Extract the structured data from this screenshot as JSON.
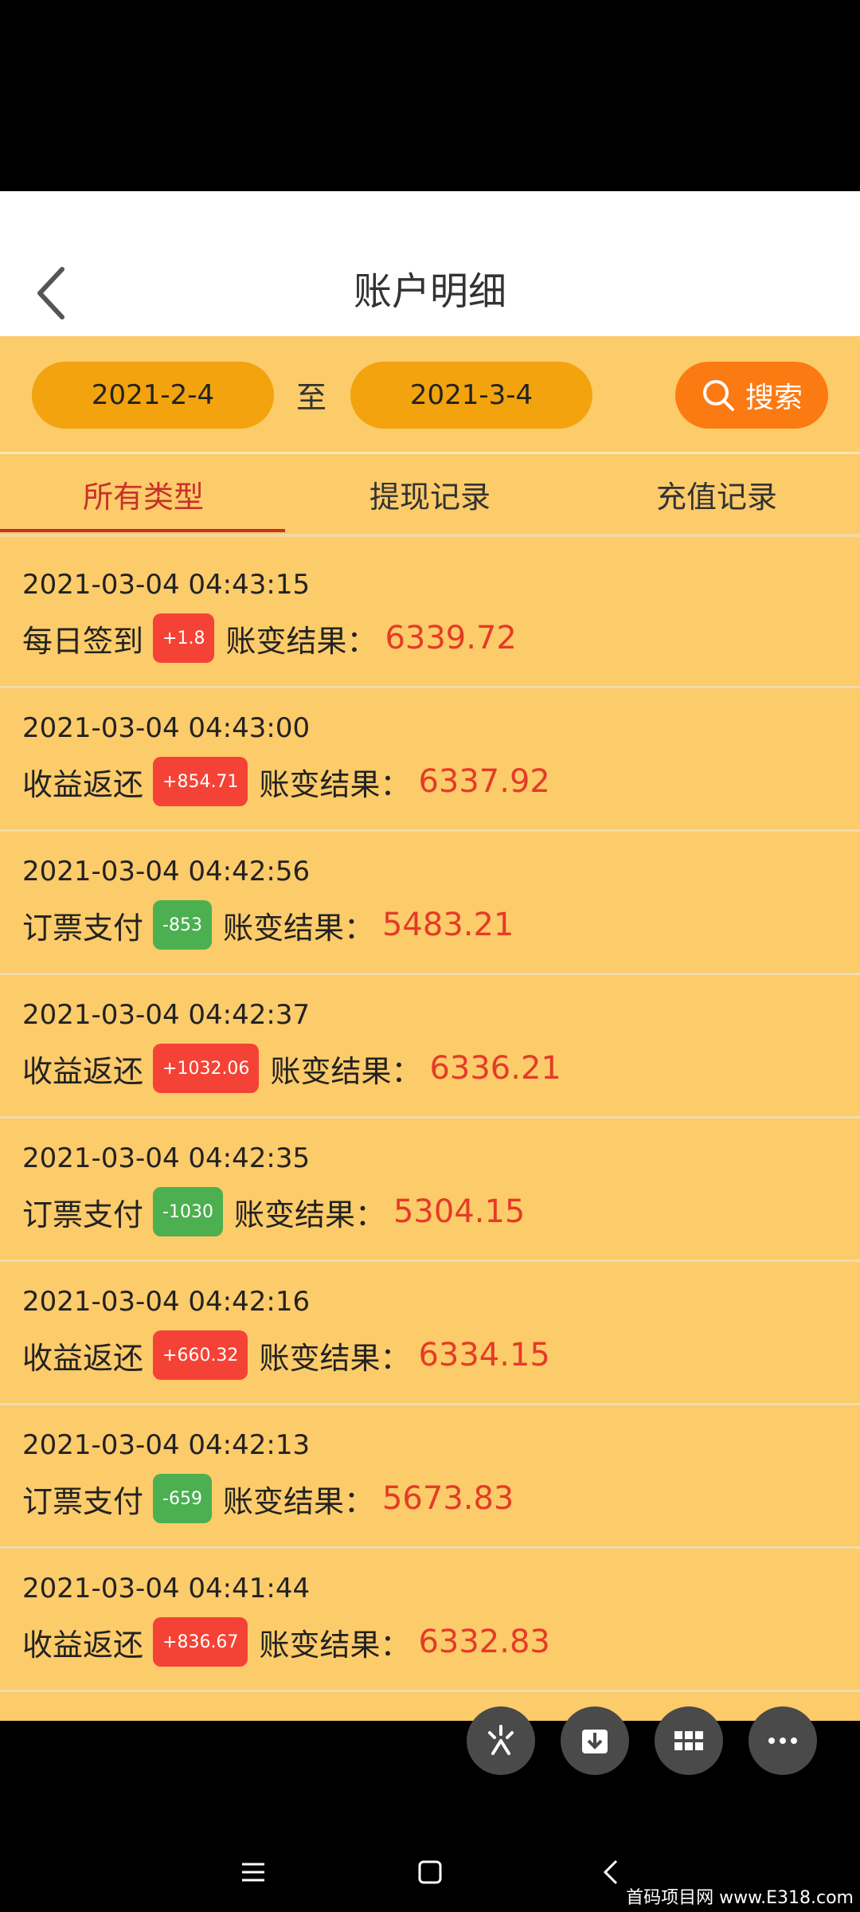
{
  "header": {
    "title": "账户明细"
  },
  "filter": {
    "date_from": "2021-2-4",
    "to_label": "至",
    "date_to": "2021-3-4",
    "search_label": "搜索"
  },
  "tabs": [
    {
      "label": "所有类型",
      "active": true
    },
    {
      "label": "提现记录",
      "active": false
    },
    {
      "label": "充值记录",
      "active": false
    }
  ],
  "result_label": "账变结果：",
  "records": [
    {
      "time": "2021-03-04 04:43:15",
      "type": "每日签到",
      "change": "+1.8",
      "result": "6339.72"
    },
    {
      "time": "2021-03-04 04:43:00",
      "type": "收益返还",
      "change": "+854.71",
      "result": "6337.92"
    },
    {
      "time": "2021-03-04 04:42:56",
      "type": "订票支付",
      "change": "-853",
      "result": "5483.21"
    },
    {
      "time": "2021-03-04 04:42:37",
      "type": "收益返还",
      "change": "+1032.06",
      "result": "6336.21"
    },
    {
      "time": "2021-03-04 04:42:35",
      "type": "订票支付",
      "change": "-1030",
      "result": "5304.15"
    },
    {
      "time": "2021-03-04 04:42:16",
      "type": "收益返还",
      "change": "+660.32",
      "result": "6334.15"
    },
    {
      "time": "2021-03-04 04:42:13",
      "type": "订票支付",
      "change": "-659",
      "result": "5673.83"
    },
    {
      "time": "2021-03-04 04:41:44",
      "type": "收益返还",
      "change": "+836.67",
      "result": "6332.83"
    }
  ],
  "watermark": "首码项目网 www.E318.com",
  "colors": {
    "background": "#fccb6a",
    "date_pill": "#f2a30e",
    "search_button": "#fb7a12",
    "active_tab": "#c8312a",
    "plus_badge": "#f44336",
    "minus_badge": "#4caf50",
    "result_value": "#e53b27"
  },
  "icons": [
    "back-arrow-icon",
    "search-icon",
    "sparkle-icon",
    "download-icon",
    "grid-icon",
    "more-icon",
    "menu-icon",
    "home-icon",
    "back-nav-icon"
  ]
}
